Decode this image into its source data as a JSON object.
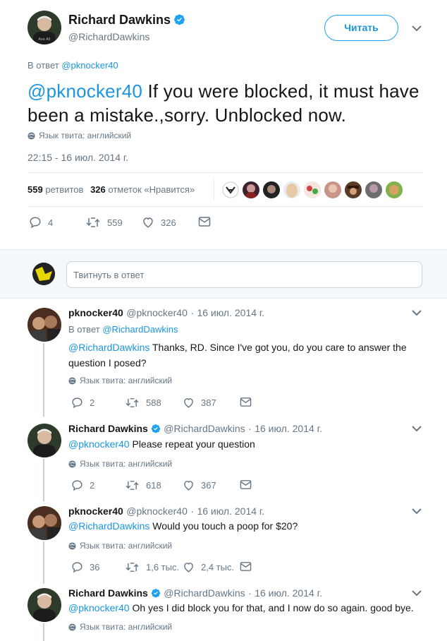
{
  "main_tweet": {
    "author_name": "Richard Dawkins",
    "author_handle": "@RichardDawkins",
    "follow_label": "Читать",
    "reply_prefix": "В ответ",
    "reply_to": "@pknocker40",
    "mention": "@pknocker40",
    "text": " If you were blocked, it must have been a mistake.,sorry. Unblocked now.",
    "language": "Язык твита: английский",
    "timestamp": "22:15 - 16 июл. 2014 г.",
    "retweets_count": "559",
    "retweets_label": "ретвитов",
    "likes_count": "326",
    "likes_label": "отметок «Нравится»",
    "actions": {
      "replies": "4",
      "retweets": "559",
      "likes": "326"
    }
  },
  "reply_box": {
    "placeholder": "Твитнуть в ответ"
  },
  "replies": [
    {
      "name": "pknocker40",
      "handle": "@pknocker40",
      "date": "16 июл. 2014 г.",
      "reply_prefix": "В ответ",
      "reply_to": "@RichardDawkins",
      "mention": "@RichardDawkins",
      "text": " Thanks, RD. Since I've got you, do you care to answer the question I posed?",
      "language": "Язык твита: английский",
      "replies": "2",
      "retweets": "588",
      "likes": "387"
    },
    {
      "name": "Richard Dawkins",
      "handle": "@RichardDawkins",
      "date": "16 июл. 2014 г.",
      "mention": "@pknocker40",
      "text": " Please repeat your question",
      "language": "Язык твита: английский",
      "replies": "2",
      "retweets": "618",
      "likes": "367"
    },
    {
      "name": "pknocker40",
      "handle": "@pknocker40",
      "date": "16 июл. 2014 г.",
      "mention": "@RichardDawkins",
      "text": " Would you touch a poop for $20?",
      "language": "Язык твита: английский",
      "replies": "36",
      "retweets": "1,6 тыс.",
      "likes": "2,4 тыс."
    },
    {
      "name": "Richard Dawkins",
      "handle": "@RichardDawkins",
      "date": "16 июл. 2014 г.",
      "mention": "@pknocker40",
      "text": " Oh yes I did block you for that, and I now do so again. good bye.",
      "language": "Язык твита: английский"
    }
  ],
  "separator": "·",
  "colors": {
    "accent": "#1da1f2",
    "link": "#1b95e0",
    "muted": "#657786",
    "border": "#e6ecf0"
  }
}
